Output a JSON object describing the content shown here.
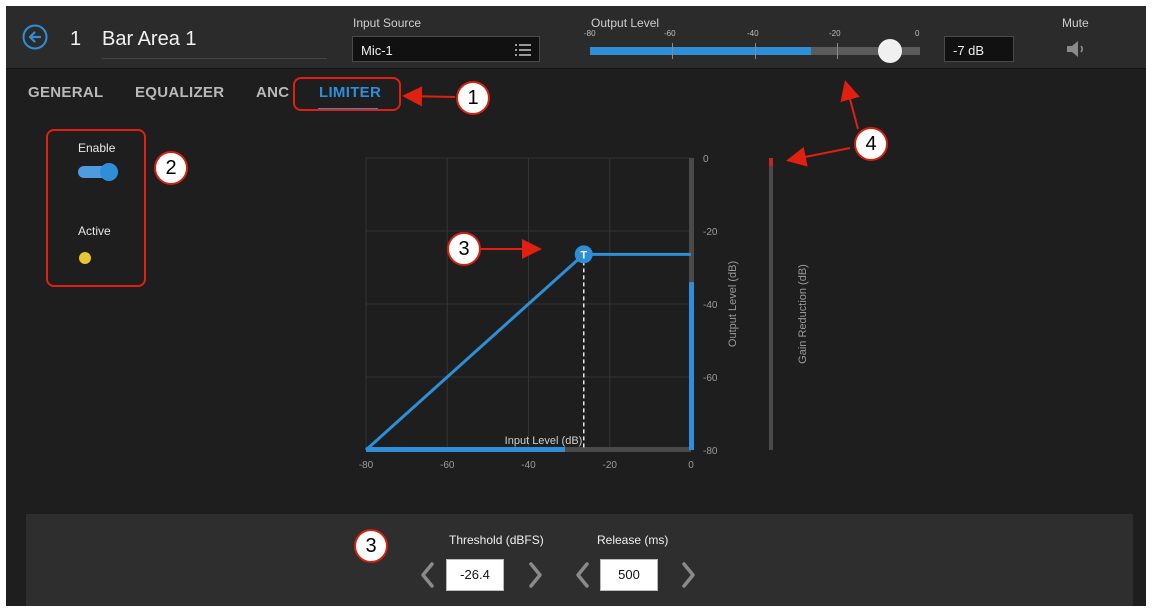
{
  "header": {
    "area_number": "1",
    "area_name": "Bar Area 1",
    "input_source_label": "Input Source",
    "input_source_value": "Mic-1",
    "output_level_label": "Output Level",
    "meter_ticks": [
      "-80",
      "-60",
      "-40",
      "-20",
      "0"
    ],
    "meter_fill_fraction": 0.67,
    "meter_knob_fraction": 0.91,
    "output_db_value": "-7 dB",
    "mute_label": "Mute"
  },
  "tabs": [
    "GENERAL",
    "EQUALIZER",
    "ANC",
    "LIMITER"
  ],
  "active_tab": "LIMITER",
  "limiter": {
    "enable_label": "Enable",
    "enabled": true,
    "active_label": "Active",
    "active_led_color": "#e8c533"
  },
  "chart_data": {
    "type": "line",
    "xlabel": "Input Level (dB)",
    "ylabel": "Output Level (dB)",
    "gain_label": "Gain Reduction (dB)",
    "xlim": [
      -80,
      0
    ],
    "ylim": [
      -80,
      0
    ],
    "x_ticks": [
      "-80",
      "-60",
      "-40",
      "-20",
      "0"
    ],
    "y_ticks": [
      "0",
      "-20",
      "-40",
      "-60",
      "-80"
    ],
    "threshold_marker": "T",
    "threshold_db": -26.4,
    "transfer_curve": [
      [
        -80,
        -80
      ],
      [
        -26.4,
        -26.4
      ],
      [
        0,
        -26.4
      ]
    ],
    "input_meter_db": -31,
    "output_meter_db": -34,
    "gain_reduction_db": 0
  },
  "controls": {
    "threshold_label": "Threshold (dBFS)",
    "threshold_value": "-26.4",
    "release_label": "Release (ms)",
    "release_value": "500"
  },
  "annotations": [
    "1",
    "2",
    "3",
    "3",
    "4"
  ],
  "colors": {
    "accent": "#2e8fd8",
    "callout": "#e02010",
    "background": "#1e1e1e"
  }
}
